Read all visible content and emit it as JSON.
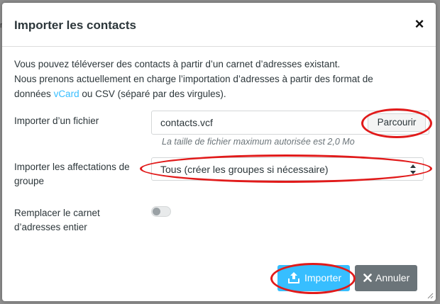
{
  "dialog": {
    "title": "Importer les contacts",
    "close_label": "×"
  },
  "intro": {
    "line1": "Vous pouvez téléverser des contacts à partir d’un carnet d’adresses existant.",
    "line2": "Nous prenons actuellement en charge l’importation d’adresses à partir des format de",
    "line3_before": "données ",
    "line3_link": "vCard",
    "line3_after": " ou CSV (séparé par des virgules)."
  },
  "file_import": {
    "label": "Importer d’un fichier",
    "value": "contacts.vcf",
    "browse_label": "Parcourir",
    "hint": "La taille de fichier maximum autorisée est 2,0 Mo"
  },
  "group_assign": {
    "label_line1": "Importer les affectations de",
    "label_line2": "groupe",
    "selected": "Tous (créer les groupes si nécessaire)"
  },
  "replace": {
    "label_line1": "Remplacer le carnet",
    "label_line2": "d’adresses entier",
    "enabled": false
  },
  "buttons": {
    "import_label": "Importer",
    "cancel_label": "Annuler"
  },
  "colors": {
    "accent": "#37beff",
    "annotation": "#e11a1a",
    "cancel": "#6b7479"
  },
  "icons": {
    "close": "close-icon",
    "select": "select-arrows-icon",
    "import": "upload-icon",
    "cancel": "x-icon",
    "resize": "resize-handle-icon"
  }
}
